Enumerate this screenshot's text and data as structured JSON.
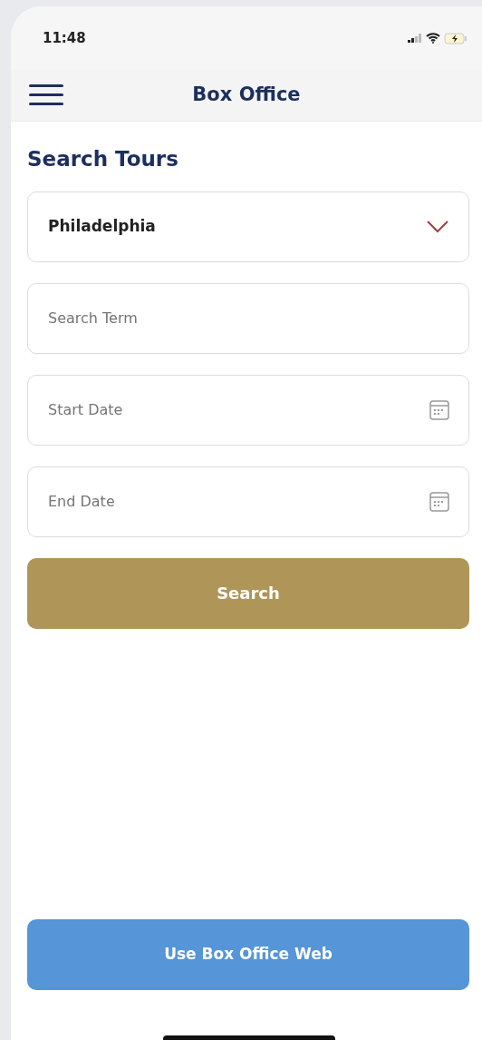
{
  "status_bar": {
    "time": "11:48"
  },
  "nav_bar": {
    "title": "Box Office"
  },
  "heading": "Search Tours",
  "fields": [
    {
      "kind": "select",
      "value": "Philadelphia"
    },
    {
      "kind": "text",
      "placeholder": "Search Term"
    },
    {
      "kind": "date",
      "placeholder": "Start Date"
    },
    {
      "kind": "date",
      "placeholder": "End Date"
    }
  ],
  "search_button": "Search",
  "web_button": "Use Box Office Web"
}
